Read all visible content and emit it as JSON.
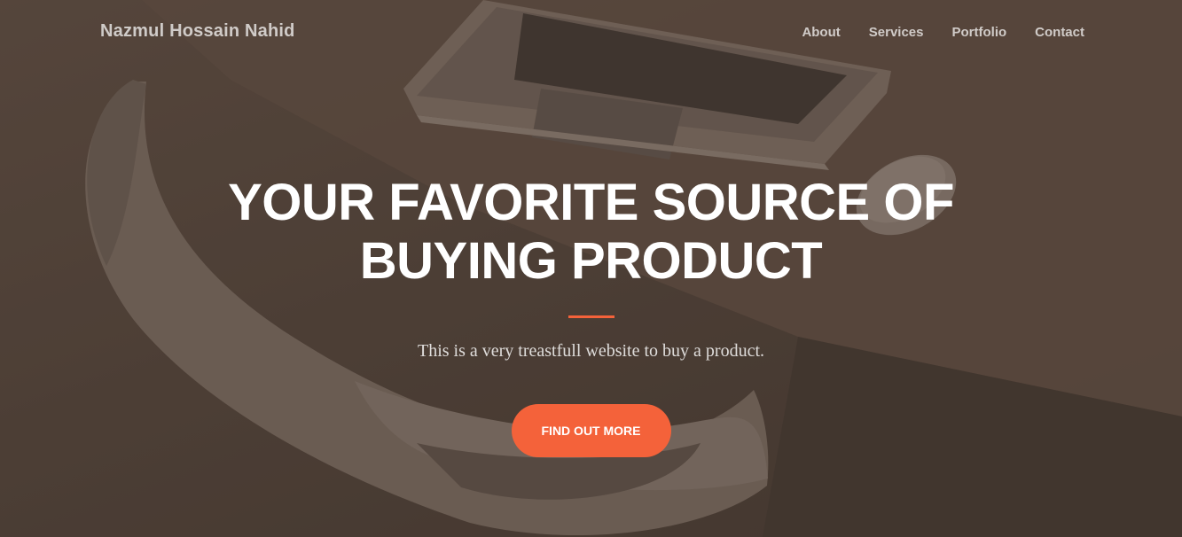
{
  "navbar": {
    "brand": "Nazmul Hossain Nahid",
    "links": [
      {
        "label": "About"
      },
      {
        "label": "Services"
      },
      {
        "label": "Portfolio"
      },
      {
        "label": "Contact"
      }
    ]
  },
  "hero": {
    "headline": "YOUR FAVORITE SOURCE OF BUYING PRODUCT",
    "subtitle": "This is a very treastfull website to buy a product.",
    "cta_label": "FIND OUT MORE",
    "background_image": "laptop-on-desk-with-chair-photo"
  },
  "colors": {
    "accent": "#f4623a",
    "overlay": "#4a3c33",
    "text": "#ffffff"
  }
}
